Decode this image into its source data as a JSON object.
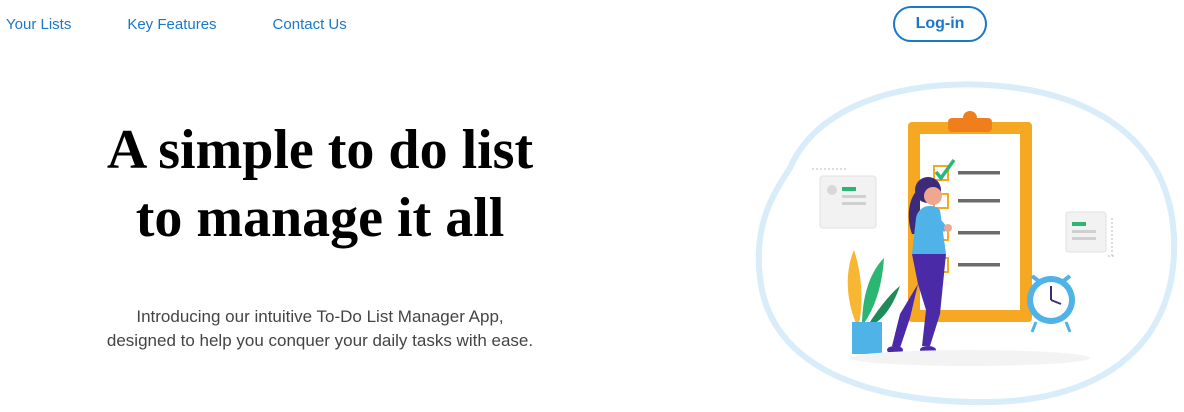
{
  "nav": {
    "links": [
      "Your Lists",
      "Key Features",
      "Contact Us"
    ],
    "login_label": "Log-in"
  },
  "hero": {
    "title_line1": "A simple to do list",
    "title_line2": "to manage it all",
    "subtitle_line1": "Introducing our intuitive To-Do List Manager App,",
    "subtitle_line2": "designed to help you conquer your daily tasks with ease."
  },
  "colors": {
    "accent": "#1a78c8",
    "clipboard": "#f7a823",
    "check": "#2bb673",
    "figure_top": "#4fb3e8",
    "figure_pants": "#4b2aa8"
  }
}
